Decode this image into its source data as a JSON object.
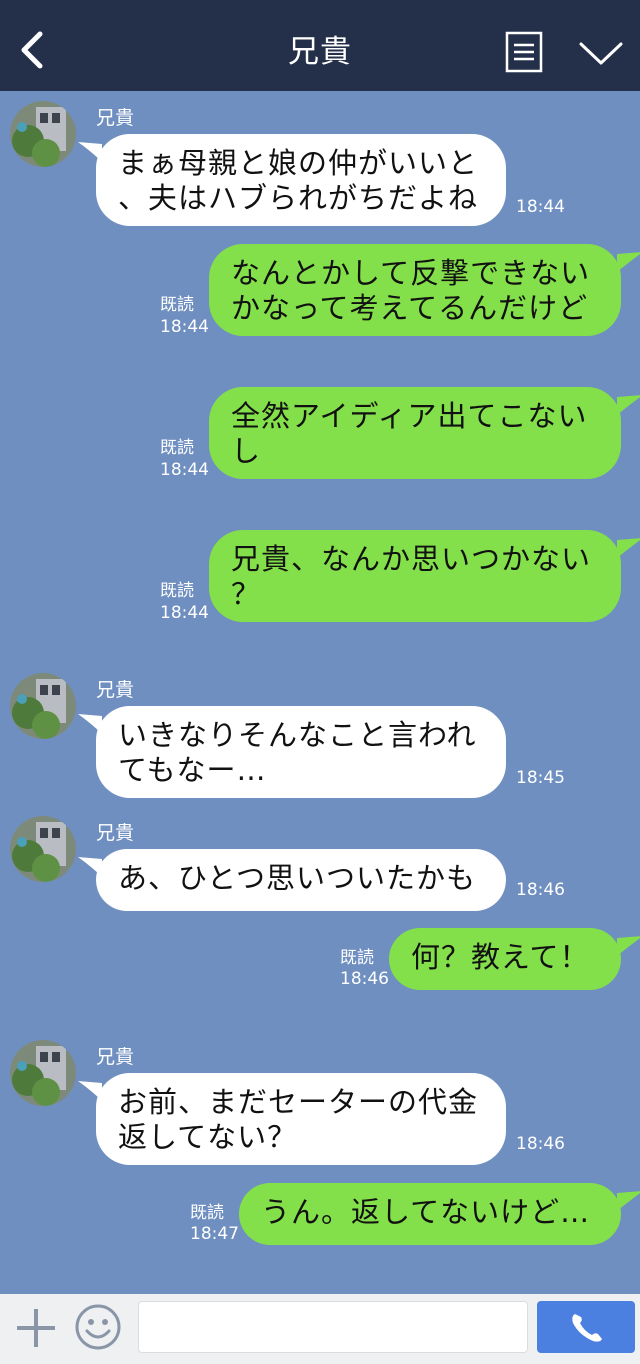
{
  "header": {
    "title": "兄貴"
  },
  "contact_name": "兄貴",
  "messages": [
    {
      "side": "left",
      "lines": [
        "まぁ母親と娘の仲がいいと",
        "、夫はハブられがちだよね"
      ],
      "time": "18:44"
    },
    {
      "side": "right",
      "lines": [
        "なんとかして反撃できない",
        "かなって考えてるんだけど"
      ],
      "read": "既読",
      "time": "18:44"
    },
    {
      "side": "right",
      "lines": [
        "全然アイディア出てこない",
        "し"
      ],
      "read": "既読",
      "time": "18:44"
    },
    {
      "side": "right",
      "lines": [
        "兄貴、なんか思いつかない",
        "？"
      ],
      "read": "既読",
      "time": "18:44"
    },
    {
      "side": "left",
      "lines": [
        "いきなりそんなこと言われ",
        "てもなー…"
      ],
      "time": "18:45"
    },
    {
      "side": "left",
      "lines": [
        "あ、ひとつ思いついたかも"
      ],
      "time": "18:46"
    },
    {
      "side": "right",
      "lines": [
        "何？教えて！"
      ],
      "read": "既読",
      "time": "18:46"
    },
    {
      "side": "left",
      "lines": [
        "お前、まだセーターの代金",
        "返してない？"
      ],
      "time": "18:46"
    },
    {
      "side": "right",
      "lines": [
        "うん。返してないけど…"
      ],
      "read": "既読",
      "time": "18:47"
    }
  ],
  "input": {
    "placeholder": ""
  },
  "colors": {
    "header_bg": "#24304a",
    "chat_bg": "#6f8fc0",
    "left_bubble": "#ffffff",
    "right_bubble": "#84e04a",
    "call_button": "#4b80e0"
  },
  "icons": [
    "back-icon",
    "menu-icon",
    "collapse-icon",
    "plus-icon",
    "emoji-icon",
    "phone-icon"
  ]
}
